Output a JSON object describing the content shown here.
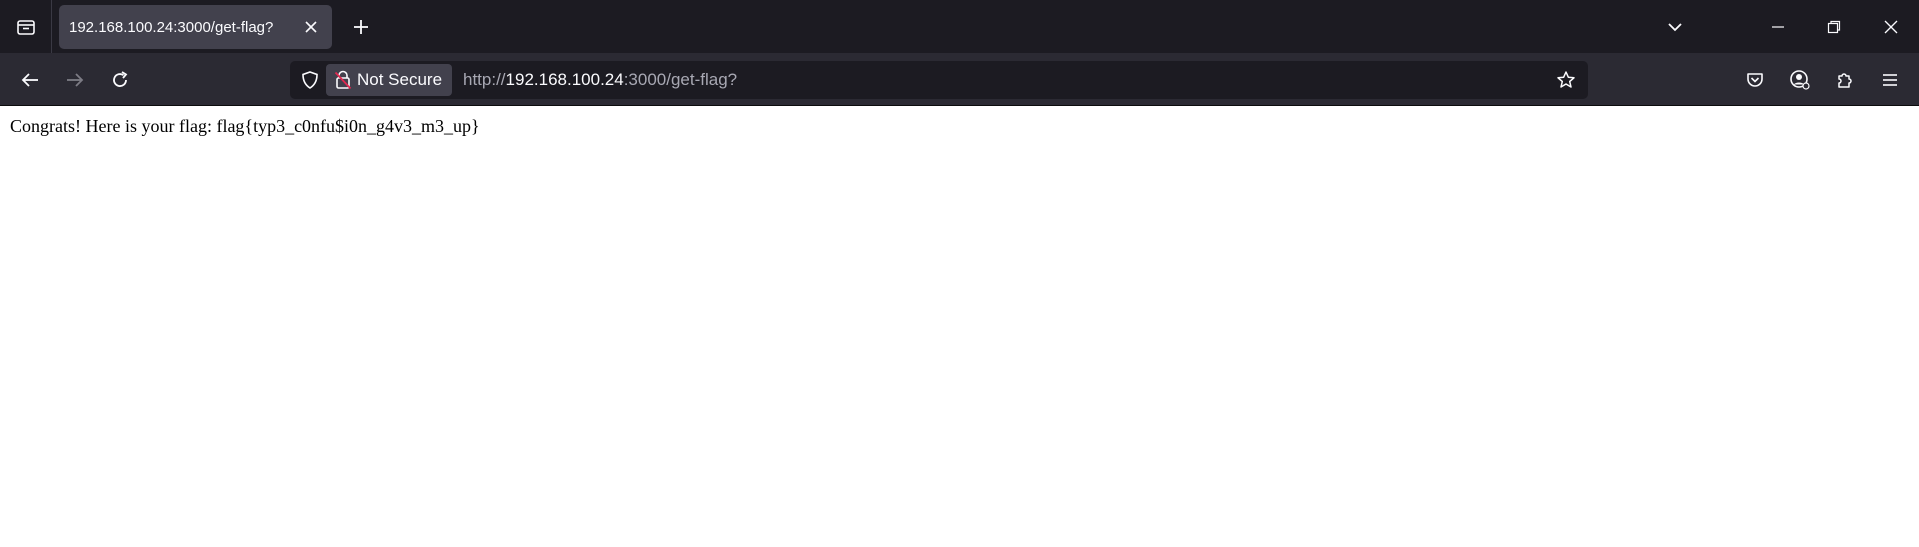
{
  "tab": {
    "title": "192.168.100.24:3000/get-flag?"
  },
  "urlbar": {
    "security_label": "Not Secure",
    "url_scheme": "http://",
    "url_host": "192.168.100.24",
    "url_rest": ":3000/get-flag?"
  },
  "page": {
    "message": "Congrats! Here is your flag: flag{typ3_c0nfu$i0n_g4v3_m3_up}"
  },
  "icons": {
    "tab_list": "tab-list-icon",
    "close": "close-icon",
    "new_tab": "plus-icon",
    "all_tabs": "chevron-down-icon",
    "minimize": "minimize-icon",
    "restore": "restore-icon",
    "window_close": "window-close-icon",
    "back": "back-arrow-icon",
    "forward": "forward-arrow-icon",
    "reload": "reload-icon",
    "tracking_protection": "shield-icon",
    "insecure": "insecure-lock-icon",
    "bookmark": "star-icon",
    "pocket": "pocket-icon",
    "account": "account-icon",
    "extensions": "extensions-icon",
    "menu": "hamburger-menu-icon"
  },
  "colors": {
    "titlebar": "#1c1b22",
    "tab_active": "#42414d",
    "navbar": "#2b2a33",
    "urlbar": "#1c1b22",
    "insecure_accent": "#e22850"
  }
}
